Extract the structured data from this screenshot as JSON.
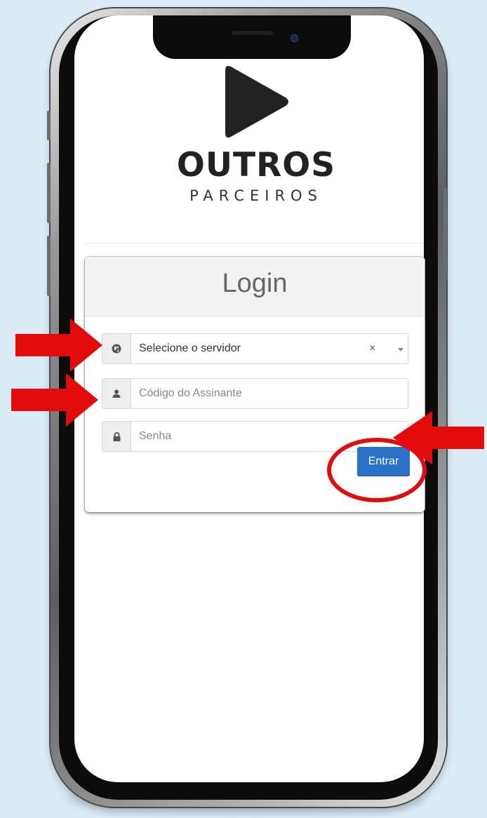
{
  "logo": {
    "title": "OUTROS",
    "subtitle": "PARCEIROS",
    "icon": "play-icon"
  },
  "login": {
    "header": "Login",
    "server_select": {
      "value": "Selecione o servidor",
      "clear": "×",
      "icon": "globe-icon"
    },
    "subscriber_code": {
      "placeholder": "Código do Assinante",
      "icon": "user-icon"
    },
    "password": {
      "placeholder": "Senha",
      "icon": "lock-icon"
    },
    "submit_label": "Entrar"
  },
  "colors": {
    "background": "#dcecf7",
    "button": "#2a72c8",
    "annotation": "#e30b0b"
  }
}
